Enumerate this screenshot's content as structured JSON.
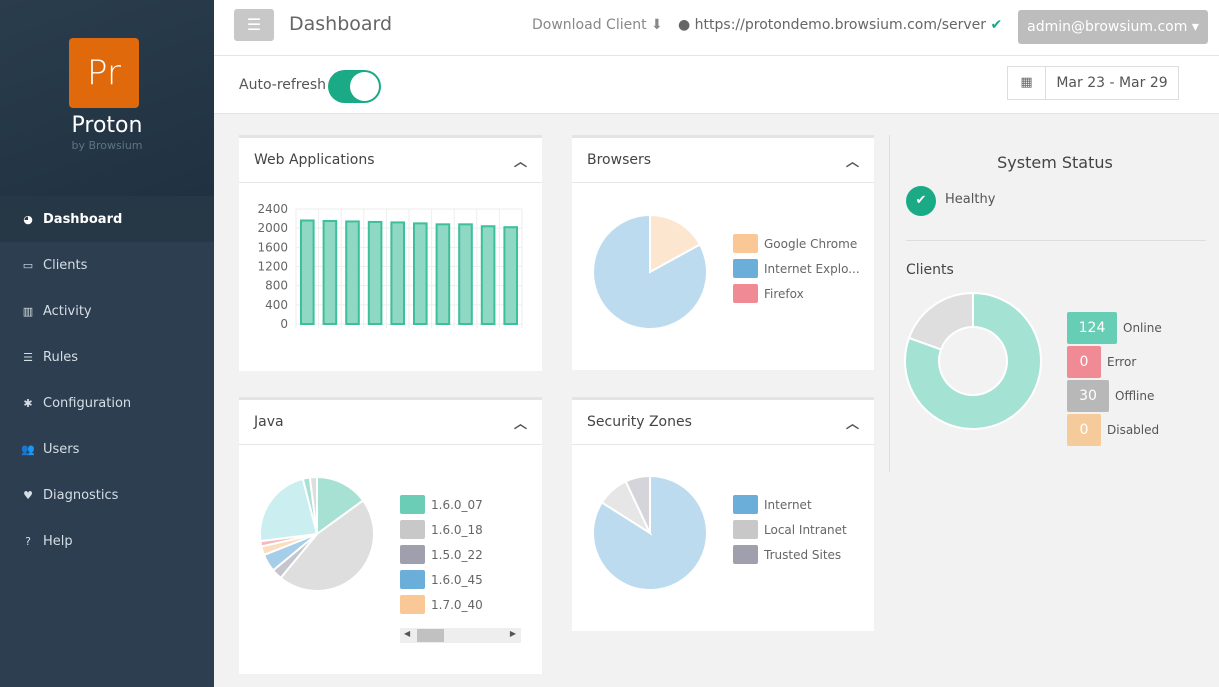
{
  "sidebar": {
    "logo_mark": "Pr",
    "app_name": "Proton",
    "app_sub": "by Browsium",
    "items": [
      {
        "label": "Dashboard",
        "icon": "dashboard-icon",
        "glyph": "◕",
        "active": true
      },
      {
        "label": "Clients",
        "icon": "laptop-icon",
        "glyph": "▭"
      },
      {
        "label": "Activity",
        "icon": "bar-chart-icon",
        "glyph": "▥"
      },
      {
        "label": "Rules",
        "icon": "server-icon",
        "glyph": "☰"
      },
      {
        "label": "Configuration",
        "icon": "gear-icon",
        "glyph": "✱"
      },
      {
        "label": "Users",
        "icon": "users-icon",
        "glyph": "👥"
      },
      {
        "label": "Diagnostics",
        "icon": "heartbeat-icon",
        "glyph": "♥"
      },
      {
        "label": "Help",
        "icon": "question-icon",
        "glyph": "?"
      }
    ]
  },
  "header": {
    "title": "Dashboard",
    "download": "Download Client ⬇",
    "server_url": "https://protondemo.browsium.com/server",
    "user": "admin@browsium.com ▾"
  },
  "subheader": {
    "auto_refresh_label": "Auto-refresh",
    "auto_refresh_on": true,
    "date_range": "Mar 23 - Mar 29"
  },
  "cards": {
    "web_apps": "Web Applications",
    "browsers": "Browsers",
    "java": "Java",
    "security": "Security Zones"
  },
  "chart_data": [
    {
      "type": "bar",
      "title": "Web Applications",
      "ylim": [
        0,
        2400
      ],
      "yticks": [
        "0",
        "400",
        "800",
        "1200",
        "1600",
        "2000",
        "2400"
      ],
      "values": [
        2160,
        2150,
        2140,
        2130,
        2120,
        2100,
        2080,
        2080,
        2040,
        2020
      ],
      "color": "#1aaa85",
      "grid": true
    },
    {
      "type": "pie",
      "title": "Browsers",
      "series": [
        {
          "name": "Google Chrome",
          "value": 17,
          "color": "#f9c896"
        },
        {
          "name": "Internet Explo...",
          "value": 83,
          "color": "#6aaed9"
        },
        {
          "name": "Firefox",
          "value": 0,
          "color": "#f08a94"
        }
      ]
    },
    {
      "type": "pie",
      "title": "Java",
      "series": [
        {
          "name": "1.6.0_07",
          "value": 15,
          "color": "#6bcdb5"
        },
        {
          "name": "1.6.0_18",
          "value": 46,
          "color": "#c8c8c8"
        },
        {
          "name": "1.5.0_22",
          "value": 3,
          "color": "#9f9fad"
        },
        {
          "name": "1.6.0_45",
          "value": 5,
          "color": "#6aaed9"
        },
        {
          "name": "1.7.0_40",
          "value": 2.5,
          "color": "#f9c896"
        },
        {
          "value": 1.5,
          "color": "#f08a94"
        },
        {
          "value": 23,
          "color": "#a8e4e6"
        },
        {
          "value": 2,
          "color": "#6bcdb5"
        },
        {
          "value": 2,
          "color": "#c8c8c8"
        }
      ]
    },
    {
      "type": "pie",
      "title": "Security Zones",
      "series": [
        {
          "name": "Internet",
          "value": 84,
          "color": "#6aaed9"
        },
        {
          "name": "Local Intranet",
          "value": 9,
          "color": "#c8c8c8"
        },
        {
          "name": "Trusted Sites",
          "value": 7,
          "color": "#9f9fad"
        }
      ]
    }
  ],
  "status": {
    "title": "System Status",
    "health": "Healthy",
    "clients_title": "Clients",
    "clients": [
      {
        "label": "Online",
        "count": "124",
        "color": "#67cdb5"
      },
      {
        "label": "Error",
        "count": "0",
        "color": "#f08a94"
      },
      {
        "label": "Offline",
        "count": "30",
        "color": "#b8b8b8"
      },
      {
        "label": "Disabled",
        "count": "0",
        "color": "#f6cb9b"
      }
    ]
  }
}
